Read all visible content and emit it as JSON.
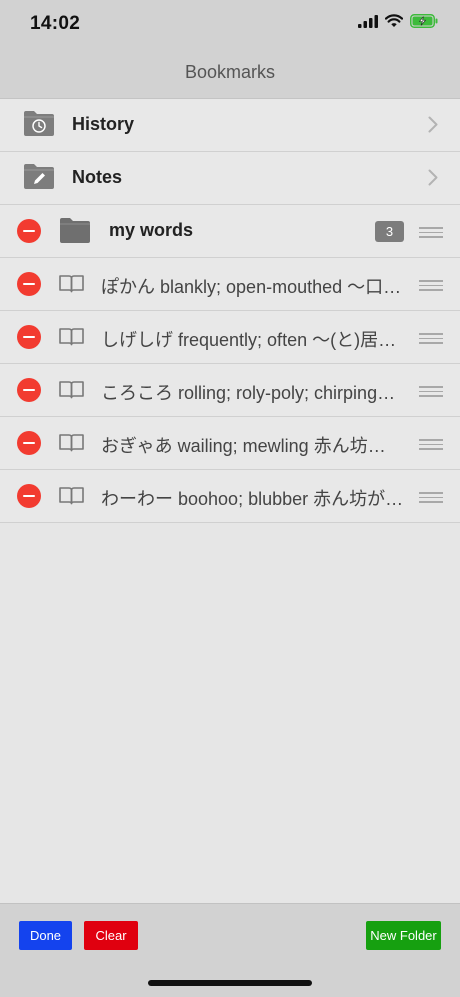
{
  "status": {
    "time": "14:02"
  },
  "nav": {
    "title": "Bookmarks"
  },
  "folders": [
    {
      "label": "History",
      "icon": "clock-folder-icon"
    },
    {
      "label": "Notes",
      "icon": "pencil-folder-icon"
    }
  ],
  "editable_folder": {
    "label": "my words",
    "count": "3"
  },
  "entries": [
    {
      "text": "ぽかん blankly; open-mouthed 〜口…"
    },
    {
      "text": "しげしげ frequently; often 〜(と)居…"
    },
    {
      "text": "ころころ rolling; roly-poly; chirping…"
    },
    {
      "text": "おぎゃあ wailing; mewling 赤ん坊…"
    },
    {
      "text": "わーわー boohoo; blubber 赤ん坊が…"
    }
  ],
  "toolbar": {
    "done": "Done",
    "clear": "Clear",
    "new_folder": "New Folder"
  },
  "colors": {
    "done": "#1443ee",
    "clear": "#e0000f",
    "new_folder": "#16a010",
    "delete": "#f23b30"
  }
}
